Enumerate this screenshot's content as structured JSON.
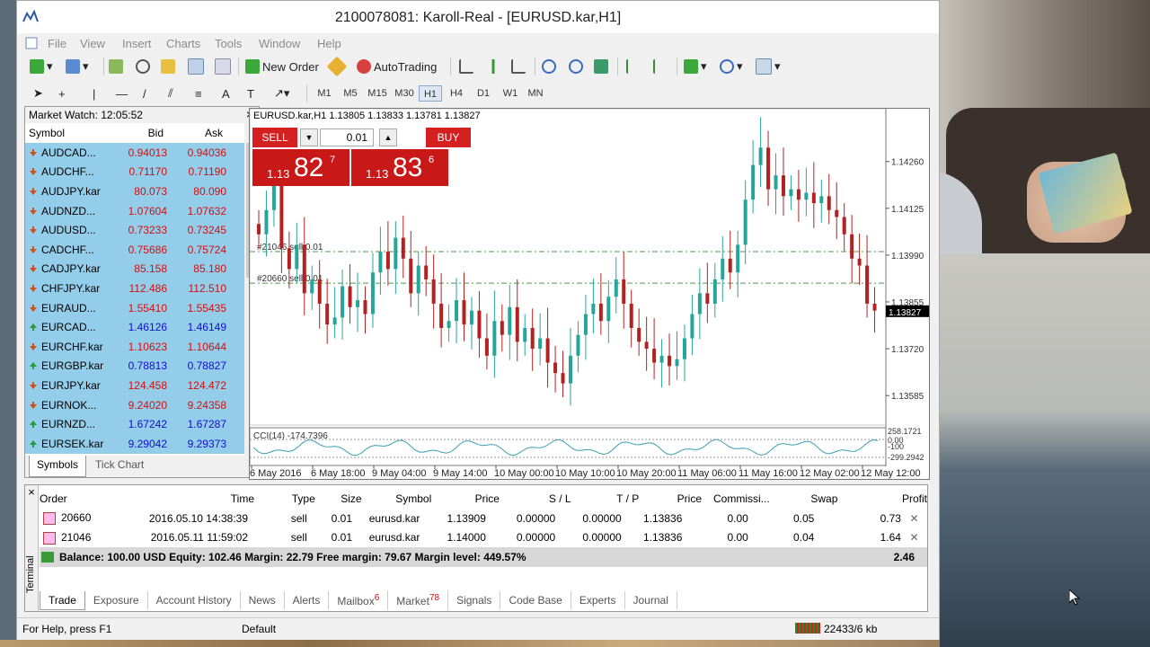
{
  "window": {
    "title": "2100078081: Karoll-Real - [EURUSD.kar,H1]"
  },
  "menu": [
    "File",
    "View",
    "Insert",
    "Charts",
    "Tools",
    "Window",
    "Help"
  ],
  "toolbar": {
    "new_order": "New Order",
    "autotrading": "AutoTrading"
  },
  "timeframes": [
    "M1",
    "M5",
    "M15",
    "M30",
    "H1",
    "H4",
    "D1",
    "W1",
    "MN"
  ],
  "timeframe_active": "H1",
  "market_watch": {
    "title": "Market Watch: 12:05:52",
    "columns": [
      "Symbol",
      "Bid",
      "Ask"
    ],
    "rows": [
      {
        "symbol": "AUDCAD...",
        "bid": "0.94013",
        "ask": "0.94036",
        "dir": "down"
      },
      {
        "symbol": "AUDCHF...",
        "bid": "0.71170",
        "ask": "0.71190",
        "dir": "down"
      },
      {
        "symbol": "AUDJPY.kar",
        "bid": "80.073",
        "ask": "80.090",
        "dir": "down"
      },
      {
        "symbol": "AUDNZD...",
        "bid": "1.07604",
        "ask": "1.07632",
        "dir": "down"
      },
      {
        "symbol": "AUDUSD...",
        "bid": "0.73233",
        "ask": "0.73245",
        "dir": "down"
      },
      {
        "symbol": "CADCHF...",
        "bid": "0.75686",
        "ask": "0.75724",
        "dir": "down"
      },
      {
        "symbol": "CADJPY.kar",
        "bid": "85.158",
        "ask": "85.180",
        "dir": "down"
      },
      {
        "symbol": "CHFJPY.kar",
        "bid": "112.486",
        "ask": "112.510",
        "dir": "down"
      },
      {
        "symbol": "EURAUD...",
        "bid": "1.55410",
        "ask": "1.55435",
        "dir": "down"
      },
      {
        "symbol": "EURCAD...",
        "bid": "1.46126",
        "ask": "1.46149",
        "dir": "up"
      },
      {
        "symbol": "EURCHF.kar",
        "bid": "1.10623",
        "ask": "1.10644",
        "dir": "down"
      },
      {
        "symbol": "EURGBP.kar",
        "bid": "0.78813",
        "ask": "0.78827",
        "dir": "up"
      },
      {
        "symbol": "EURJPY.kar",
        "bid": "124.458",
        "ask": "124.472",
        "dir": "down"
      },
      {
        "symbol": "EURNOK...",
        "bid": "9.24020",
        "ask": "9.24358",
        "dir": "down"
      },
      {
        "symbol": "EURNZD...",
        "bid": "1.67242",
        "ask": "1.67287",
        "dir": "up"
      },
      {
        "symbol": "EURSEK.kar",
        "bid": "9.29042",
        "ask": "9.29373",
        "dir": "up"
      }
    ],
    "tabs": [
      "Symbols",
      "Tick Chart"
    ]
  },
  "chart": {
    "info": "EURUSD.kar,H1  1.13805 1.13833 1.13781 1.13827",
    "sell_label": "SELL",
    "buy_label": "BUY",
    "lot": "0.01",
    "sell_price": {
      "prefix": "1.13",
      "big": "82",
      "sup": "7"
    },
    "buy_price": {
      "prefix": "1.13",
      "big": "83",
      "sup": "6"
    },
    "order_lines": [
      "#21046 sell 0.01",
      "#20660 sell 0.01"
    ],
    "indicator_label": "CCI(14) -174.7396",
    "indicator_ticks": [
      "258.1721",
      "0.00",
      "-100",
      "-299.2942"
    ],
    "current_price": "1.13827"
  },
  "chart_data": {
    "type": "candlestick",
    "title": "EURUSD.kar,H1",
    "y_ticks": [
      "1.14260",
      "1.14125",
      "1.13990",
      "1.13855",
      "1.13720",
      "1.13585"
    ],
    "x_ticks": [
      "6 May 2016",
      "6 May 18:00",
      "9 May 04:00",
      "9 May 14:00",
      "10 May 00:00",
      "10 May 10:00",
      "10 May 20:00",
      "11 May 06:00",
      "11 May 16:00",
      "12 May 02:00",
      "12 May 12:00"
    ],
    "ylim": [
      1.135,
      1.1435
    ],
    "close": [
      1.1405,
      1.1412,
      1.142,
      1.1401,
      1.1395,
      1.1402,
      1.1388,
      1.1392,
      1.1385,
      1.1379,
      1.1381,
      1.139,
      1.1384,
      1.1386,
      1.1382,
      1.1394,
      1.14,
      1.1395,
      1.1404,
      1.1398,
      1.1388,
      1.1396,
      1.1392,
      1.1385,
      1.1378,
      1.138,
      1.1386,
      1.1379,
      1.1383,
      1.1375,
      1.137,
      1.138,
      1.1376,
      1.1384,
      1.1374,
      1.1378,
      1.1372,
      1.1375,
      1.1368,
      1.1365,
      1.1362,
      1.137,
      1.1376,
      1.1382,
      1.1385,
      1.138,
      1.1387,
      1.1392,
      1.1385,
      1.1378,
      1.1374,
      1.1372,
      1.1368,
      1.137,
      1.1367,
      1.1369,
      1.1375,
      1.1382,
      1.1388,
      1.1385,
      1.1392,
      1.1398,
      1.1394,
      1.1402,
      1.1415,
      1.1425,
      1.143,
      1.1418,
      1.1422,
      1.1416,
      1.1418,
      1.1415,
      1.1417,
      1.1414,
      1.1416,
      1.1412,
      1.141,
      1.1405,
      1.1398,
      1.1396,
      1.1385,
      1.1383
    ]
  },
  "terminal": {
    "columns": [
      "Order",
      "Time",
      "Type",
      "Size",
      "Symbol",
      "Price",
      "S / L",
      "T / P",
      "Price",
      "Commissi...",
      "Swap",
      "Profit"
    ],
    "rows": [
      {
        "order": "20660",
        "time": "2016.05.10 14:38:39",
        "type": "sell",
        "size": "0.01",
        "symbol": "eurusd.kar",
        "price": "1.13909",
        "sl": "0.00000",
        "tp": "0.00000",
        "cur": "1.13836",
        "com": "0.00",
        "swap": "0.05",
        "profit": "0.73"
      },
      {
        "order": "21046",
        "time": "2016.05.11 11:59:02",
        "type": "sell",
        "size": "0.01",
        "symbol": "eurusd.kar",
        "price": "1.14000",
        "sl": "0.00000",
        "tp": "0.00000",
        "cur": "1.13836",
        "com": "0.00",
        "swap": "0.04",
        "profit": "1.64"
      }
    ],
    "balance_line": "Balance: 100.00 USD  Equity: 102.46  Margin: 22.79  Free margin: 79.67  Margin level: 449.57%",
    "balance_total": "2.46",
    "tabs": [
      {
        "label": "Trade",
        "badge": ""
      },
      {
        "label": "Exposure",
        "badge": ""
      },
      {
        "label": "Account History",
        "badge": ""
      },
      {
        "label": "News",
        "badge": ""
      },
      {
        "label": "Alerts",
        "badge": ""
      },
      {
        "label": "Mailbox",
        "badge": "6"
      },
      {
        "label": "Market",
        "badge": "78"
      },
      {
        "label": "Signals",
        "badge": ""
      },
      {
        "label": "Code Base",
        "badge": ""
      },
      {
        "label": "Experts",
        "badge": ""
      },
      {
        "label": "Journal",
        "badge": ""
      }
    ],
    "side_label": "Terminal"
  },
  "status": {
    "help": "For Help, press F1",
    "profile": "Default",
    "traffic": "22433/6 kb"
  },
  "colors": {
    "bull": "#26a69a",
    "bear": "#b22222",
    "sell": "#d42020",
    "mw_row": "#93cdea"
  }
}
